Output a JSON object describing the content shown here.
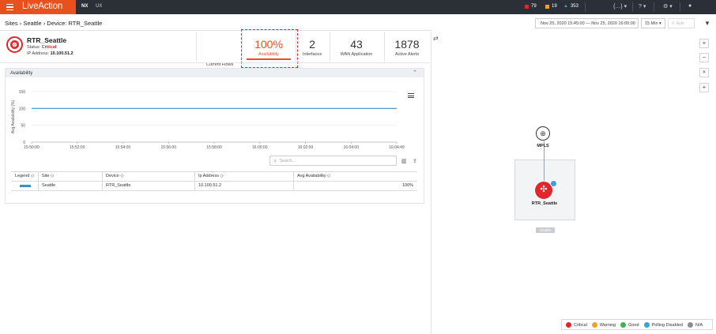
{
  "topbar": {
    "logo": "LiveAction",
    "nav": [
      "NX",
      "UX"
    ],
    "alerts": {
      "critical": "79",
      "warning": "19",
      "info": "353"
    },
    "alert_colors": {
      "critical": "#e3262c",
      "warning": "#f0a030",
      "info": "#3aa0d8"
    },
    "icons": [
      "code-brackets-icon",
      "help-icon",
      "gear-icon",
      "user-icon"
    ]
  },
  "breadcrumb": [
    "Sites",
    "Seattle",
    "Device: RTR_Seattle"
  ],
  "time": {
    "range": "Nov 25, 2020 15:45:00 — Nov 25, 2020 16:00:00",
    "interval": "15 Min",
    "auto": "Auto"
  },
  "device": {
    "name": "RTR_Seattle",
    "status_label": "Status:",
    "status": "Critical",
    "ip_label": "IP Address:",
    "ip": "10.100.51.2"
  },
  "stats": [
    {
      "value": "",
      "label": "Current Flows"
    },
    {
      "value": "100%",
      "label": "Availability"
    },
    {
      "value": "2",
      "label": "Interfaces"
    },
    {
      "value": "43",
      "label": "WAN Application"
    },
    {
      "value": "1878",
      "label": "Active Alerts"
    }
  ],
  "panel": {
    "title": "Availability",
    "search_placeholder": "Search..."
  },
  "chart_data": {
    "type": "line",
    "ylabel": "Avg Availability (%)",
    "yticks": [
      0,
      50,
      100,
      150
    ],
    "ylim": [
      0,
      150
    ],
    "x": [
      "15:50:00",
      "15:52:00",
      "15:54:00",
      "15:56:00",
      "15:58:00",
      "16:00:00",
      "16:02:00",
      "16:04:00",
      "16:04:49"
    ],
    "series": [
      {
        "values": [
          100,
          100,
          100,
          100,
          100,
          100,
          100,
          100,
          100
        ],
        "color": "#3d8ec9"
      }
    ]
  },
  "table": {
    "headers": [
      "Legend",
      "Site",
      "Device",
      "Ip Address",
      "Avg Availability"
    ],
    "rows": [
      {
        "site": "Seattle",
        "device": "RTR_Seattle",
        "ip": "10.100.51.2",
        "avail": "100%"
      }
    ]
  },
  "topology": {
    "cloud": "MPLS",
    "router": "RTR_Seattle",
    "site": "Seattle"
  },
  "legend": [
    {
      "label": "Critical",
      "color": "#e3262c"
    },
    {
      "label": "Warning",
      "color": "#f0a030"
    },
    {
      "label": "Good",
      "color": "#3cb44b"
    },
    {
      "label": "Polling Disabled",
      "color": "#3aa0d8"
    },
    {
      "label": "N/A",
      "color": "#8a8f96"
    }
  ]
}
